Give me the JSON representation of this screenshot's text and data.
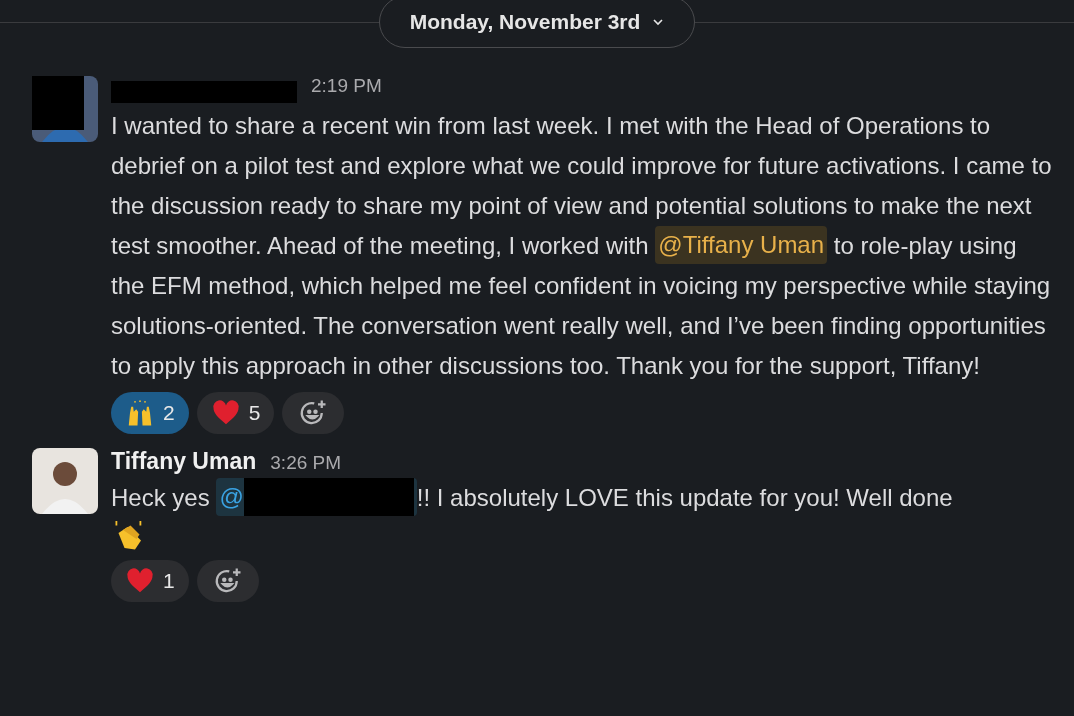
{
  "date_divider": {
    "label": "Monday, November 3rd"
  },
  "messages": [
    {
      "author": {
        "redacted": true
      },
      "time": "2:19 PM",
      "avatar_redacted": true,
      "body": [
        {
          "kind": "text",
          "text": "I wanted to share a recent win from last week. I met with the Head of Operations to debrief on a pilot test and explore what we could improve for future activations. I came to the discussion ready to share my point of view and potential solutions to make the next test smoother. Ahead of the meeting, I worked with "
        },
        {
          "kind": "mention",
          "text": "@Tiffany Uman",
          "redacted": false,
          "highlighted": true
        },
        {
          "kind": "text",
          "text": " to role-play using the EFM method, which helped me feel confident in voicing my perspective while staying solutions-oriented. The conversation went really well, and I’ve been finding opportunities to apply this approach in other discussions too. Thank you for the support, Tiffany!"
        }
      ],
      "reactions": [
        {
          "kind": "raised-hands",
          "count": "2",
          "selected": true
        },
        {
          "kind": "heart",
          "count": "5",
          "selected": false
        }
      ]
    },
    {
      "author": {
        "name": "Tiffany Uman",
        "redacted": false
      },
      "time": "3:26 PM",
      "avatar_redacted": false,
      "body": [
        {
          "kind": "text",
          "text": "Heck yes "
        },
        {
          "kind": "mention",
          "text": "@",
          "redacted": true,
          "highlighted": false
        },
        {
          "kind": "text",
          "text": "!!  I absolutely LOVE this update for you! Well done"
        },
        {
          "kind": "clap"
        }
      ],
      "reactions": [
        {
          "kind": "heart",
          "count": "1",
          "selected": false
        }
      ]
    }
  ]
}
